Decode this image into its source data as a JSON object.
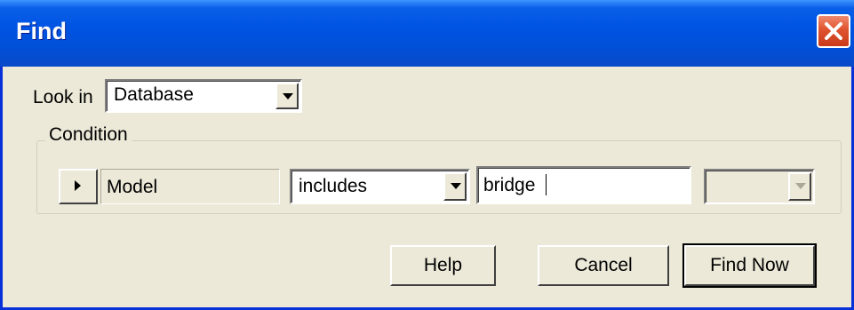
{
  "window": {
    "title": "Find"
  },
  "look_in": {
    "label": "Look in",
    "value": "Database"
  },
  "condition": {
    "legend": "Condition",
    "field": "Model",
    "operator": "includes",
    "value": "bridge",
    "extra_value": ""
  },
  "buttons": {
    "help": "Help",
    "cancel": "Cancel",
    "find_now": "Find Now"
  },
  "colors": {
    "title_bar": "#0054e3",
    "close_button": "#e0532f",
    "dialog_background": "#ece9d8"
  }
}
